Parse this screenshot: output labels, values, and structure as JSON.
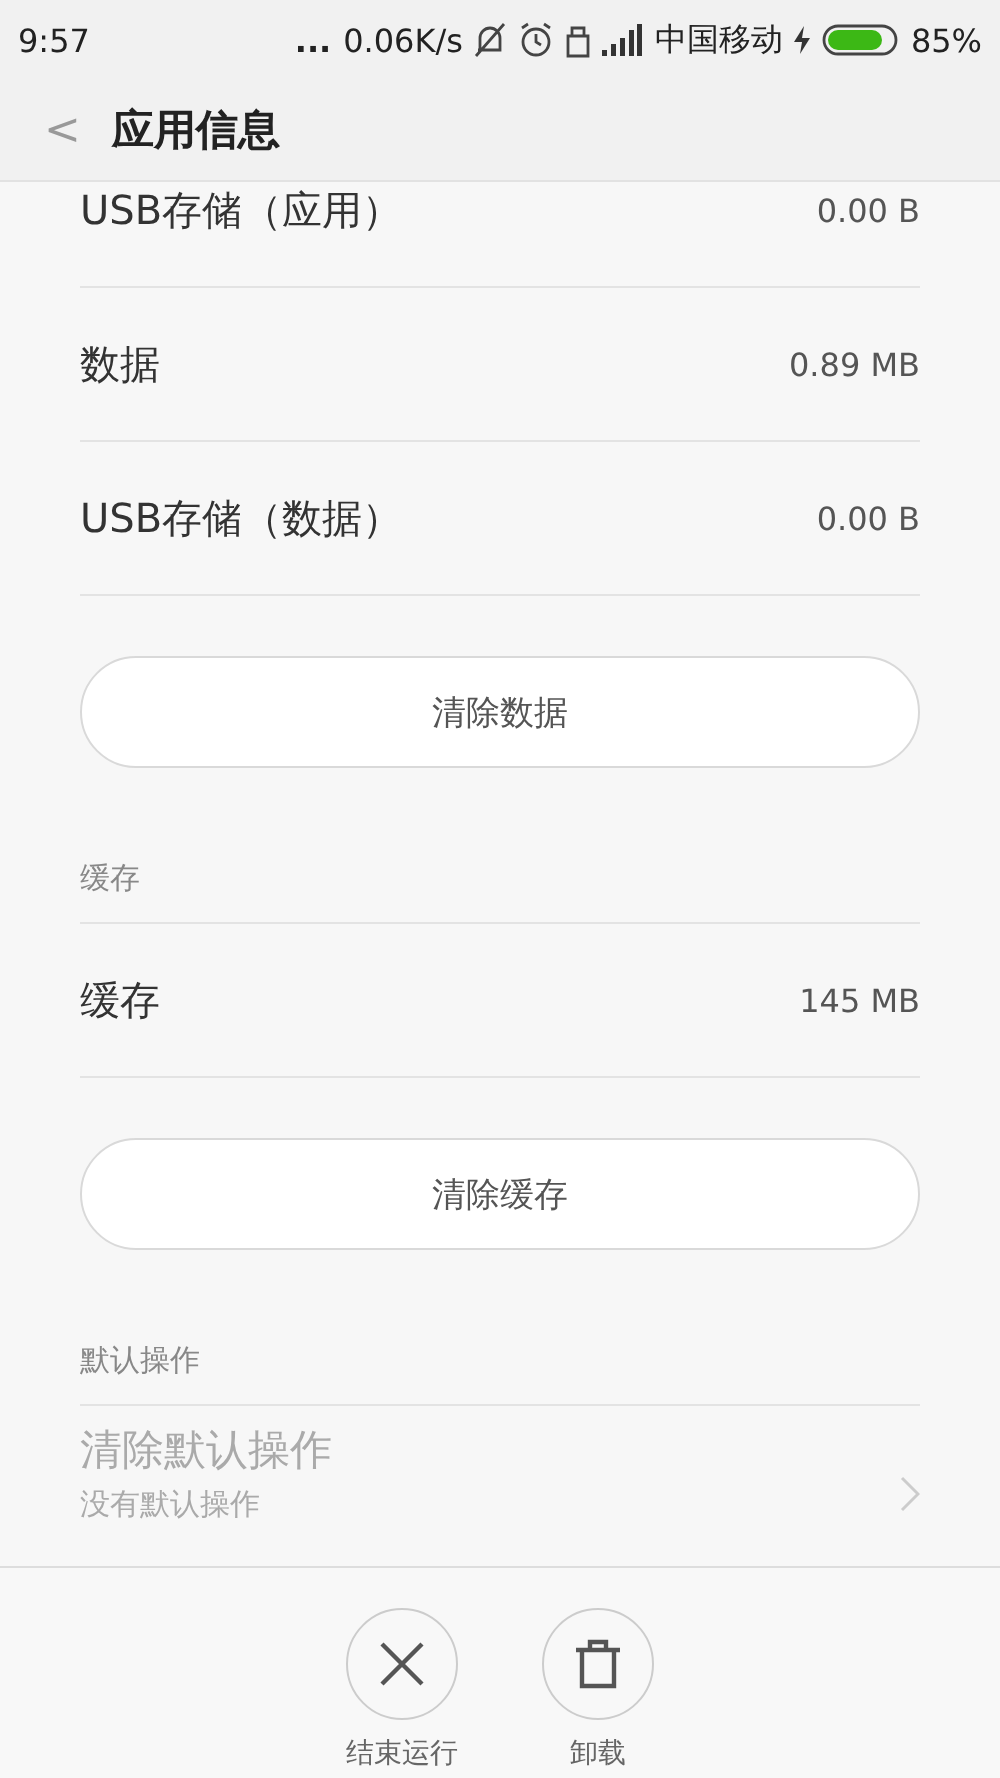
{
  "status_bar": {
    "time": "9:57",
    "dots": "...",
    "speed": "0.06K/s",
    "carrier": "中国移动",
    "battery": "85%"
  },
  "header": {
    "back": "<",
    "title": "应用信息"
  },
  "sections": [
    {
      "kind": "plain",
      "items": [
        {
          "label": "USB存储（应用）",
          "value": "0.00 B"
        },
        {
          "label": "数据",
          "value": "0.89 MB"
        },
        {
          "label": "USB存储（数据）",
          "value": "0.00 B"
        }
      ],
      "button": "清除数据"
    },
    {
      "kind": "titled",
      "title": "缓存",
      "items": [
        {
          "label": "缓存",
          "value": "145 MB"
        }
      ],
      "button": "清除缓存"
    },
    {
      "kind": "titled",
      "title": "默认操作",
      "links": [
        {
          "label": "清除默认操作",
          "subtitle": "没有默认操作",
          "disabled": true
        }
      ]
    }
  ],
  "actions": [
    {
      "kind": "close",
      "label": "结束运行"
    },
    {
      "kind": "trash",
      "label": "卸载"
    }
  ]
}
